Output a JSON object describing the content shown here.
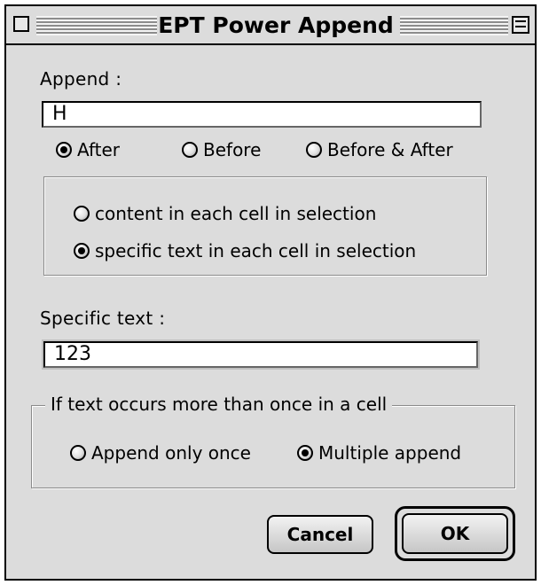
{
  "window": {
    "title": "EPT Power Append"
  },
  "append": {
    "label": "Append :",
    "value": "H",
    "position_options": [
      {
        "label": "After",
        "selected": true
      },
      {
        "label": "Before",
        "selected": false
      },
      {
        "label": "Before & After",
        "selected": false
      }
    ]
  },
  "scope": {
    "options": [
      {
        "label": "content in each cell in selection",
        "selected": false
      },
      {
        "label": "specific text in each cell in selection",
        "selected": true
      }
    ]
  },
  "specific": {
    "label": "Specific text :",
    "value": "123"
  },
  "occurrence": {
    "group_title": "If text occurs more than once in a cell",
    "options": [
      {
        "label": "Append only once",
        "selected": false
      },
      {
        "label": "Multiple append",
        "selected": true
      }
    ]
  },
  "buttons": {
    "cancel_label": "Cancel",
    "ok_label": "OK"
  }
}
